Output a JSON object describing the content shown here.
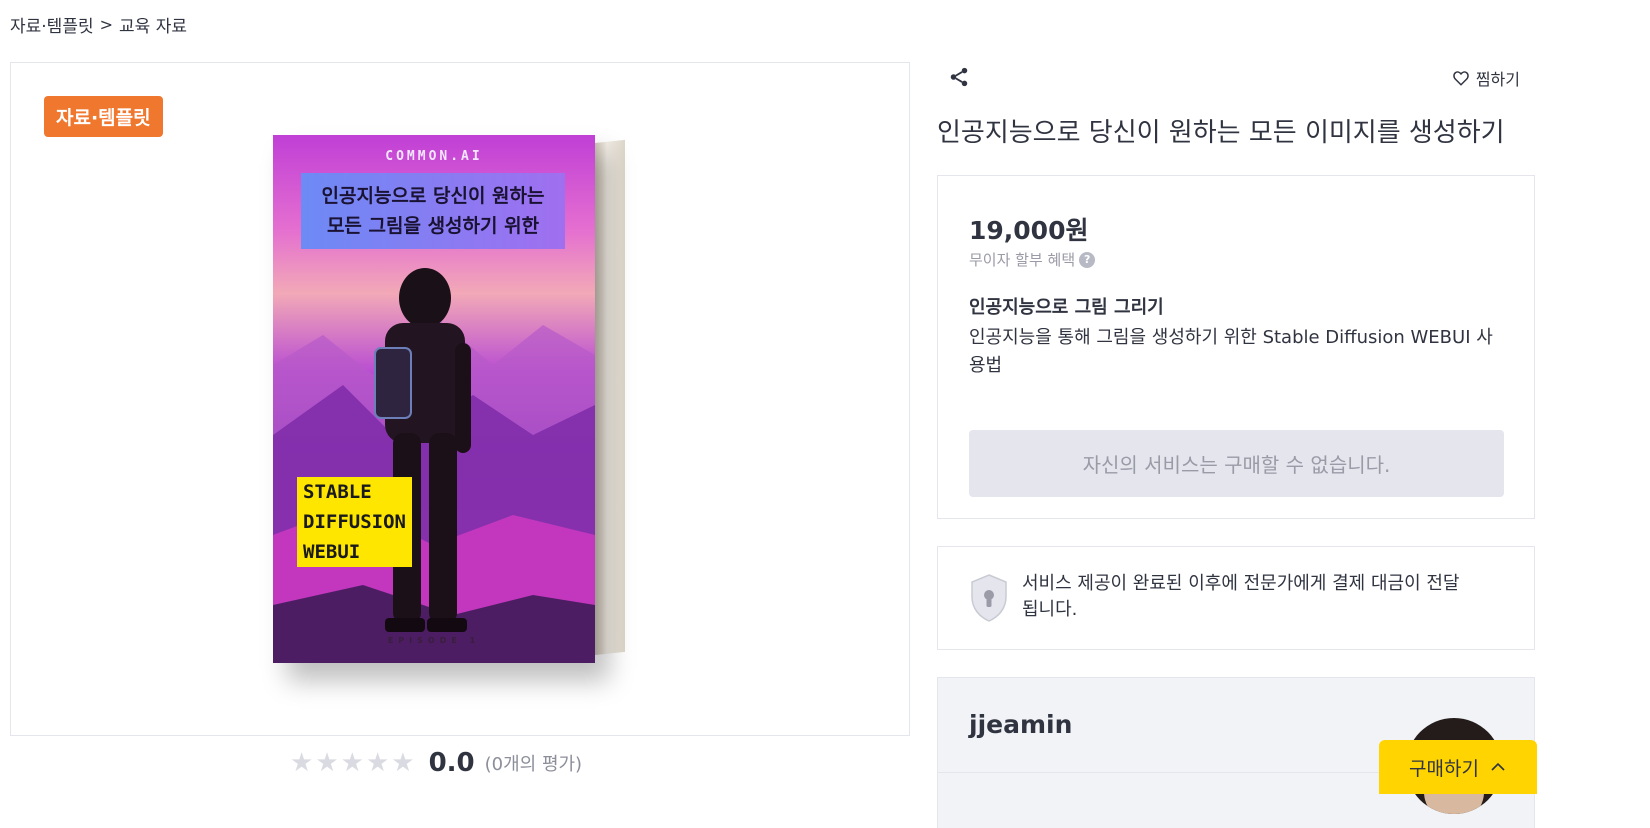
{
  "breadcrumb": {
    "category": "자료·템플릿",
    "separator": ">",
    "subcategory": "교육 자료"
  },
  "gallery": {
    "badge": "자료·템플릿",
    "cover": {
      "brand": "COMMON.AI",
      "title_line1": "인공지능으로 당신이 원하는",
      "title_line2": "모든 그림을 생성하기 위한",
      "label_line1": "STABLE",
      "label_line2": "DIFFUSION",
      "label_line3": "WEBUI",
      "episode": "EPISODE 1"
    }
  },
  "rating": {
    "score": "0.0",
    "count": "(0개의 평가)",
    "stars_filled": 0,
    "stars_total": 5
  },
  "actions": {
    "wish_label": "찜하기",
    "share_icon": "share-icon",
    "wish_icon": "heart-icon"
  },
  "product": {
    "title": "인공지능으로 당신이 원하는 모든 이미지를 생성하기",
    "price": "19,000원",
    "installment": "무이자 할부 혜택",
    "package_title": "인공지능으로 그림 그리기",
    "package_desc": "인공지능을 통해 그림을 생성하기 위한 Stable Diffusion WEBUI 사용법",
    "buy_disabled_label": "자신의 서비스는 구매할 수 없습니다."
  },
  "guarantee": {
    "text": "서비스 제공이 완료된 이후에 전문가에게 결제 대금이 전달됩니다."
  },
  "seller": {
    "name": "jjeamin"
  },
  "sticky": {
    "buy_label": "구매하기"
  },
  "colors": {
    "badge": "#f0772e",
    "buy_sticky": "#ffd400",
    "disabled_button": "#e4e5ed",
    "text": "#303441"
  }
}
